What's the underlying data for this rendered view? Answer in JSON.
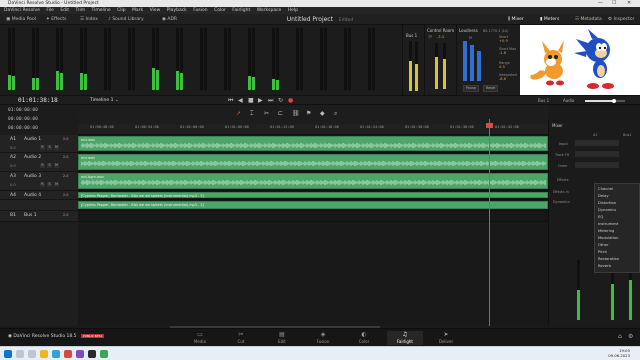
{
  "window": {
    "title": "DaVinci Resolve Studio - Untitled Project",
    "controls": [
      "—",
      "☐",
      "✕"
    ]
  },
  "menu": [
    "DaVinci Resolve",
    "File",
    "Edit",
    "Trim",
    "Timeline",
    "Clip",
    "Mark",
    "View",
    "Playback",
    "Fusion",
    "Color",
    "Fairlight",
    "Workspace",
    "Help"
  ],
  "toolbar": {
    "left": [
      "Media Pool",
      "Effects",
      "Index",
      "Sound Library",
      "ADR"
    ],
    "project_title": "Untitled Project",
    "edited": "Edited",
    "right": [
      "Mixer",
      "Meters",
      "Metadata",
      "Inspector"
    ]
  },
  "meters": {
    "levels": [
      0.25,
      0.2,
      0.3,
      0.28,
      0.0,
      0.0,
      0.35,
      0.3,
      0.0,
      0.0,
      0.22,
      0.18,
      0.0,
      0.0,
      0.0,
      0.0
    ],
    "bus_label": "Bus 1",
    "bus_levels": [
      0.6,
      0.55
    ]
  },
  "control_room": {
    "title": "Control Room",
    "tp": "TP",
    "tp_value": "-3.3",
    "levels": [
      0.7,
      0.65
    ]
  },
  "loudness": {
    "title": "Loudness",
    "standard": "BS.1770-1 (LU)",
    "m_label": "M",
    "m_value": "-16.2",
    "short": "Short",
    "short_value": "+0.9",
    "short_max": "Short Max",
    "short_max_value": "-1.8",
    "range": "Range",
    "range_value": "4.3",
    "integrated": "Integrated",
    "integrated_value": "-8.6",
    "pause": "Pause",
    "reset": "Reset"
  },
  "transport": {
    "timecode": "01:01:38:18",
    "timeline_name": "Timeline 1",
    "bus_label": "Bus 1",
    "audio_label": "Audio"
  },
  "timecodes": [
    "01:00:00:00",
    "00:00:00:00"
  ],
  "ruler": [
    "01:00:48:00",
    "01:00:54:00",
    "01:01:00:00",
    "01:01:06:00",
    "01:01:12:00",
    "01:01:18:00",
    "01:01:24:00",
    "01:01:30:00",
    "01:01:36:00",
    "01:01:42:00"
  ],
  "tracks": [
    {
      "id": "A1",
      "name": "Audio 1",
      "fx": "2.0",
      "vol": "0.0",
      "clip": "mcl.wav",
      "clip_width": 470,
      "wave": true
    },
    {
      "id": "A2",
      "name": "Audio 2",
      "fx": "2.0",
      "vol": "0.0",
      "clip": "mcl.wav",
      "clip_width": 470,
      "wave": true
    },
    {
      "id": "A3",
      "name": "Audio 3",
      "fx": "2.0",
      "vol": "0.0",
      "clip": "mcl.bgm.wav",
      "clip_width": 470,
      "wave": true
    },
    {
      "id": "A4",
      "name": "Audio 4",
      "fx": "2.0",
      "vol": "-2.4",
      "clip": "[Cypress Pepper, Bardwaler - Kiss we we sweets (instrumental).mp3 - 2]",
      "clip_width": 470,
      "wave": false
    },
    {
      "id": "",
      "name": "",
      "fx": "",
      "vol": "",
      "clip": "[Cypress Pepper, Bardwaler - Kiss we we sweets (instrumental).mp3 - 3]",
      "clip_width": 470,
      "wave": false
    },
    {
      "id": "B1",
      "name": "Bus 1",
      "fx": "2.0",
      "vol": "0.0",
      "clip": "",
      "clip_width": 0,
      "wave": false
    }
  ],
  "mixer": {
    "title": "Mixer",
    "columns": [
      "A1",
      "Bus1"
    ],
    "row_labels": [
      "Input",
      "Track FX",
      "Order",
      "Effects",
      "Effects In",
      "Dynamics"
    ],
    "dropdown_items": [
      "Channel",
      "Delay",
      "Distortion",
      "Dynamics",
      "EQ",
      "Instrument",
      "Metering",
      "Modulation",
      "Other",
      "Pitch",
      "Restoration",
      "Reverb"
    ]
  },
  "pages": {
    "logo_text": "DaVinci Resolve Studio 18.5",
    "badge": "PUBLIC BETA",
    "tabs": [
      {
        "label": "Media",
        "icon": "▭"
      },
      {
        "label": "Cut",
        "icon": "✂"
      },
      {
        "label": "Edit",
        "icon": "▤"
      },
      {
        "label": "Fusion",
        "icon": "◈"
      },
      {
        "label": "Color",
        "icon": "◐"
      },
      {
        "label": "Fairlight",
        "icon": "♫"
      },
      {
        "label": "Deliver",
        "icon": "➤"
      }
    ],
    "active": "Fairlight"
  },
  "taskbar": {
    "time": "19:05",
    "date": "09.06.2023"
  },
  "colors": {
    "clip_green": "#4ea56a",
    "playhead_red": "#e04848",
    "meter_green": "#3fbf3f"
  }
}
